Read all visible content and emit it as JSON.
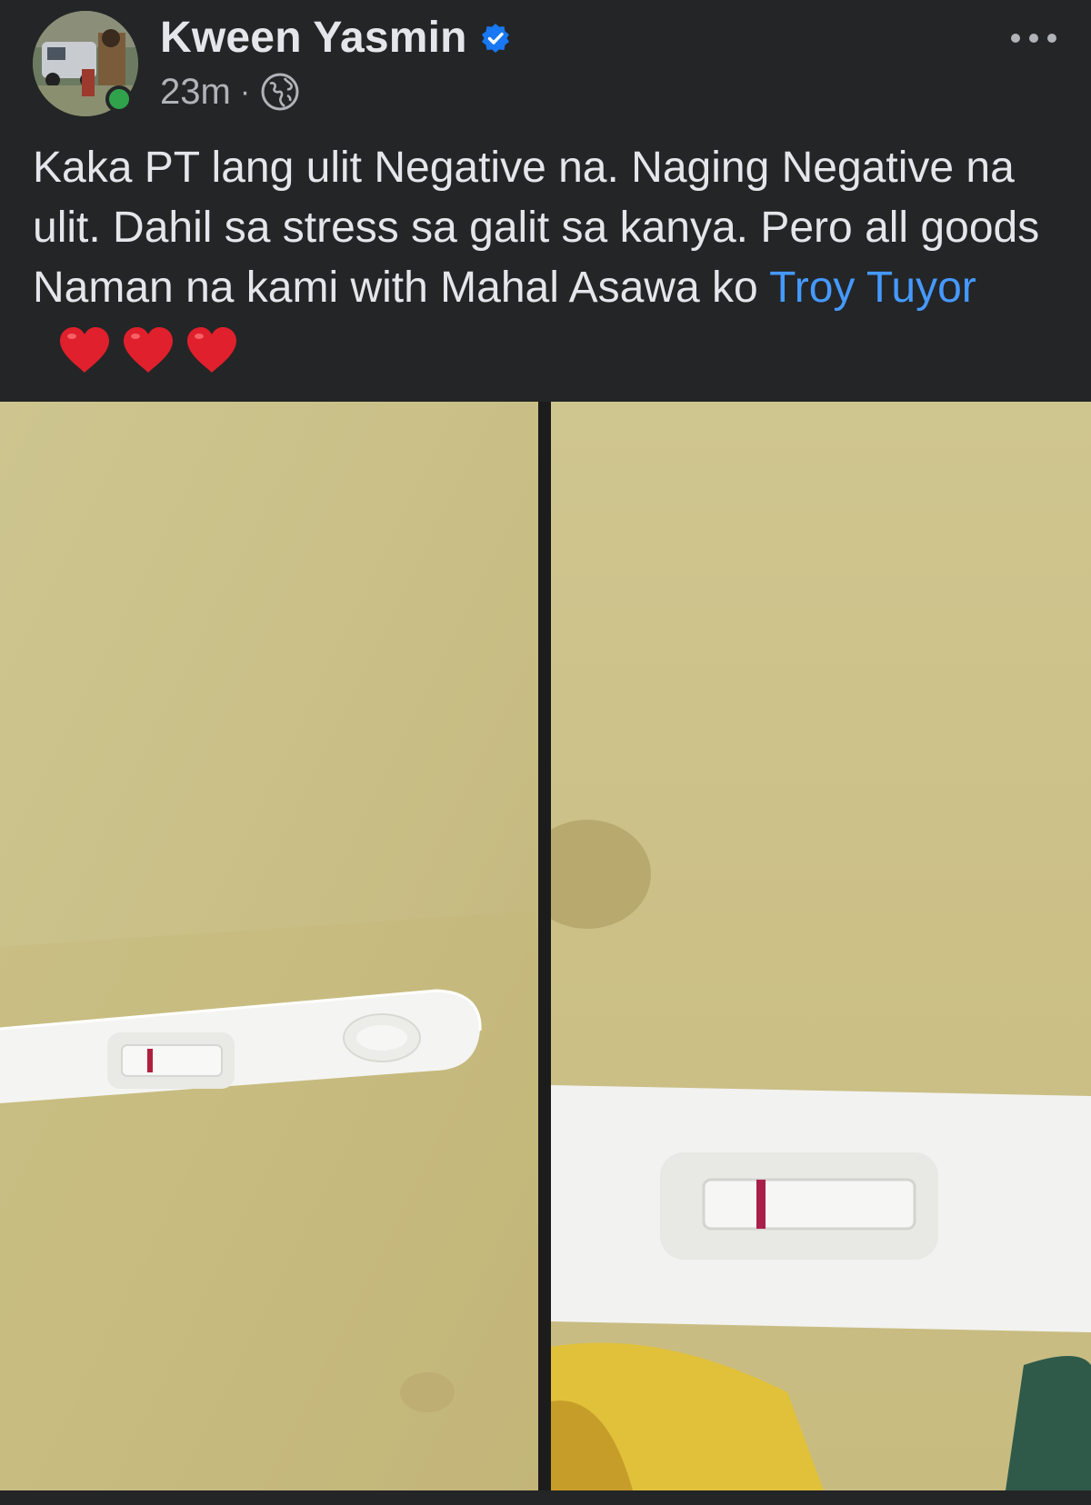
{
  "post": {
    "author": "Kween Yasmin",
    "time": "23m",
    "separator": "·",
    "text_main": "Kaka PT lang ulit Negative na. Naging Negative na ulit. Dahil sa stress sa galit sa kanya. Pero all goods Naman na kami with Mahal Asawa ko ",
    "mention": "Troy Tuyor",
    "hearts": [
      "heart-icon",
      "heart-icon",
      "heart-icon"
    ]
  },
  "icons": {
    "verified": "verified-badge-icon",
    "privacy": "globe-icon",
    "menu": "more-options-icon"
  },
  "colors": {
    "background": "#242526",
    "text": "#e4e6eb",
    "muted": "#b0b3b8",
    "mention": "#4599ff",
    "verified": "#1877f2",
    "online": "#31a24c",
    "heart": "#e0202c"
  },
  "photos": [
    {
      "name": "pregnancy-test-photo-1"
    },
    {
      "name": "pregnancy-test-photo-2"
    }
  ]
}
